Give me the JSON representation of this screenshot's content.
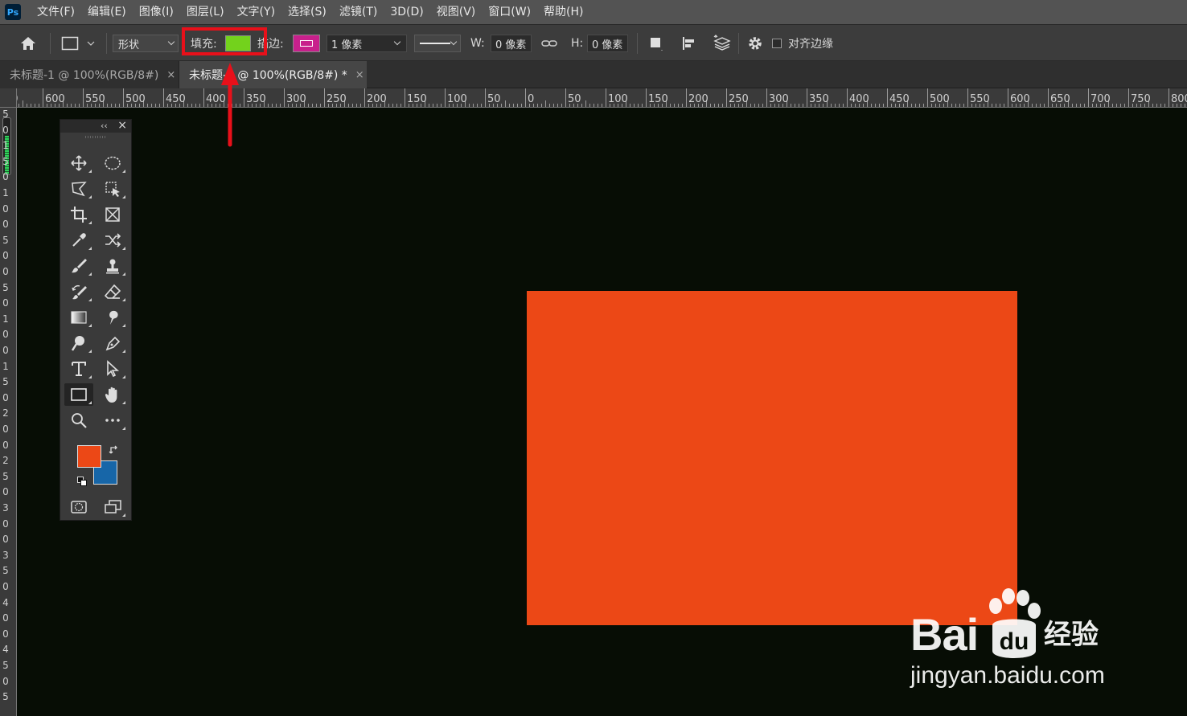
{
  "app": {
    "logo_text": "Ps"
  },
  "menu": [
    "文件(F)",
    "编辑(E)",
    "图像(I)",
    "图层(L)",
    "文字(Y)",
    "选择(S)",
    "滤镜(T)",
    "3D(D)",
    "视图(V)",
    "窗口(W)",
    "帮助(H)"
  ],
  "options": {
    "mode_value": "形状",
    "fill_label": "填充:",
    "stroke_label": "描边:",
    "stroke_width_value": "1 像素",
    "w_label": "W:",
    "w_value": "0 像素",
    "h_label": "H:",
    "h_value": "0 像素",
    "align_edges_label": "对齐边缘",
    "fill_color": "#73d21c",
    "stroke_color": "#c8208c"
  },
  "tabs": [
    {
      "title": "未标题-1 @ 100%(RGB/8#)",
      "close": "×"
    },
    {
      "title": "未标题-2 @ 100%(RGB/8#) *",
      "close": "×"
    }
  ],
  "rulers": {
    "horizontal_labels": [
      "50",
      "600",
      "550",
      "500",
      "450",
      "400",
      "350",
      "300",
      "250",
      "200",
      "150",
      "100",
      "50",
      "0",
      "50",
      "100",
      "150",
      "200",
      "250",
      "300",
      "350",
      "400",
      "450",
      "500",
      "550",
      "600",
      "650",
      "700",
      "750",
      "800"
    ],
    "vertical_labels": [
      "5",
      "0",
      "1",
      "5",
      "0",
      "1",
      "0",
      "0",
      "5",
      "0",
      "0",
      "5",
      "0",
      "1",
      "0",
      "0",
      "1",
      "5",
      "0",
      "2",
      "0",
      "0",
      "2",
      "5",
      "0",
      "3",
      "0",
      "0",
      "3",
      "5",
      "0",
      "4",
      "0",
      "0",
      "4",
      "5",
      "0",
      "5"
    ]
  },
  "tools_panel": {
    "collapse_glyph": "‹‹",
    "close_glyph": "×",
    "foreground_color": "#ec4816",
    "background_color": "#1766a8"
  },
  "canvas": {
    "background_color": "#070d05",
    "shape_color": "#ec4816"
  },
  "watermark": {
    "brand": "Bai",
    "brand_cn": "经验",
    "url": "jingyan.baidu.com"
  },
  "annotation": {
    "color": "#e8101a"
  }
}
